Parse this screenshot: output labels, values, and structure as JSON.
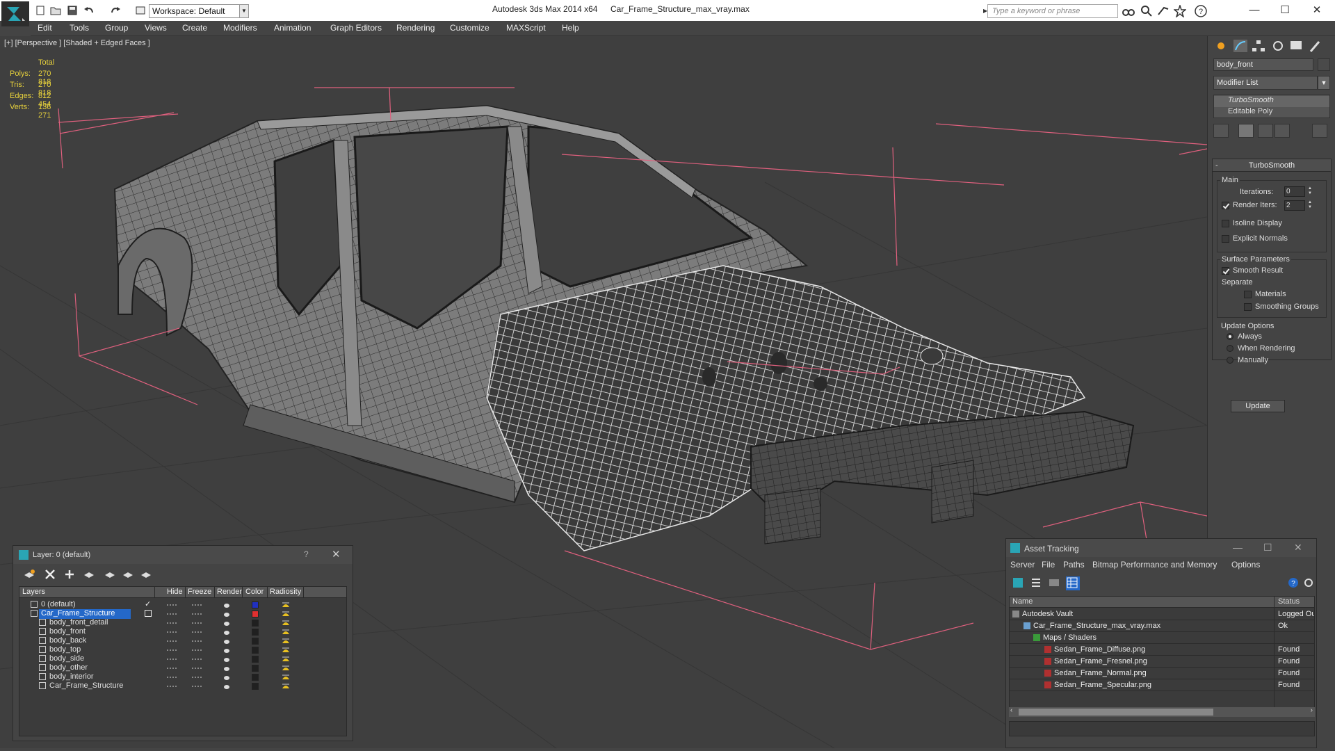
{
  "titlebar": {
    "workspace": "Workspace: Default",
    "app_title": "Autodesk 3ds Max  2014 x64",
    "file_title": "Car_Frame_Structure_max_vray.max",
    "search_placeholder": "Type a keyword or phrase"
  },
  "menu": [
    "Edit",
    "Tools",
    "Group",
    "Views",
    "Create",
    "Modifiers",
    "Animation",
    "Graph Editors",
    "Rendering",
    "Customize",
    "MAXScript",
    "Help"
  ],
  "viewport": {
    "label": "[+] [Perspective ] [Shaded + Edged Faces ]",
    "stats": {
      "header": "Total",
      "rows": [
        {
          "key": "Polys:",
          "value": "270 818"
        },
        {
          "key": "Tris:",
          "value": "270 818"
        },
        {
          "key": "Edges:",
          "value": "812 454"
        },
        {
          "key": "Verts:",
          "value": "136 271"
        }
      ]
    }
  },
  "command_panel": {
    "object_name": "body_front",
    "modifier_list": "Modifier List",
    "stack": [
      "TurboSmooth",
      "Editable Poly"
    ],
    "rollout_title": "TurboSmooth",
    "main_label": "Main",
    "iterations_label": "Iterations:",
    "iterations_value": "0",
    "render_iters_label": "Render Iters:",
    "render_iters_value": "2",
    "isoline_label": "Isoline Display",
    "explicit_normals_label": "Explicit Normals",
    "surface_params_label": "Surface Parameters",
    "smooth_result_label": "Smooth Result",
    "separate_label": "Separate",
    "materials_label": "Materials",
    "smoothing_groups_label": "Smoothing Groups",
    "update_options_label": "Update Options",
    "always_label": "Always",
    "when_rendering_label": "When Rendering",
    "manually_label": "Manually",
    "update_button": "Update"
  },
  "layer_dialog": {
    "title": "Layer: 0 (default)",
    "help": "?",
    "columns": [
      "Layers",
      "Hide",
      "Freeze",
      "Render",
      "Color",
      "Radiosity"
    ],
    "rows": [
      {
        "name": "0 (default)",
        "color": "#2030c0",
        "indent": 1
      },
      {
        "name": "Car_Frame_Structure",
        "color": "#e03030",
        "indent": 1
      },
      {
        "name": "body_front_detail",
        "color": "#202020",
        "indent": 2
      },
      {
        "name": "body_front",
        "color": "#202020",
        "indent": 2
      },
      {
        "name": "body_back",
        "color": "#202020",
        "indent": 2
      },
      {
        "name": "body_top",
        "color": "#202020",
        "indent": 2
      },
      {
        "name": "body_side",
        "color": "#202020",
        "indent": 2
      },
      {
        "name": "body_other",
        "color": "#202020",
        "indent": 2
      },
      {
        "name": "body_interior",
        "color": "#202020",
        "indent": 2
      },
      {
        "name": "Car_Frame_Structure",
        "color": "#202020",
        "indent": 2
      }
    ]
  },
  "asset_tracking": {
    "title": "Asset Tracking",
    "menu": [
      "Server",
      "File",
      "Paths",
      "Bitmap Performance and Memory",
      "Options"
    ],
    "columns": [
      "Name",
      "Status"
    ],
    "rows": [
      {
        "name": "Autodesk Vault",
        "status": "Logged Ou",
        "indent": 1
      },
      {
        "name": "Car_Frame_Structure_max_vray.max",
        "status": "Ok",
        "indent": 2
      },
      {
        "name": "Maps / Shaders",
        "status": "",
        "indent": 3
      },
      {
        "name": "Sedan_Frame_Diffuse.png",
        "status": "Found",
        "indent": 4
      },
      {
        "name": "Sedan_Frame_Fresnel.png",
        "status": "Found",
        "indent": 4
      },
      {
        "name": "Sedan_Frame_Normal.png",
        "status": "Found",
        "indent": 4
      },
      {
        "name": "Sedan_Frame_Specular.png",
        "status": "Found",
        "indent": 4
      }
    ]
  },
  "colors": {
    "accent_selection": "#2468c8",
    "stats_yellow": "#e8d23c",
    "gizmo_pink": "#e0607e"
  }
}
